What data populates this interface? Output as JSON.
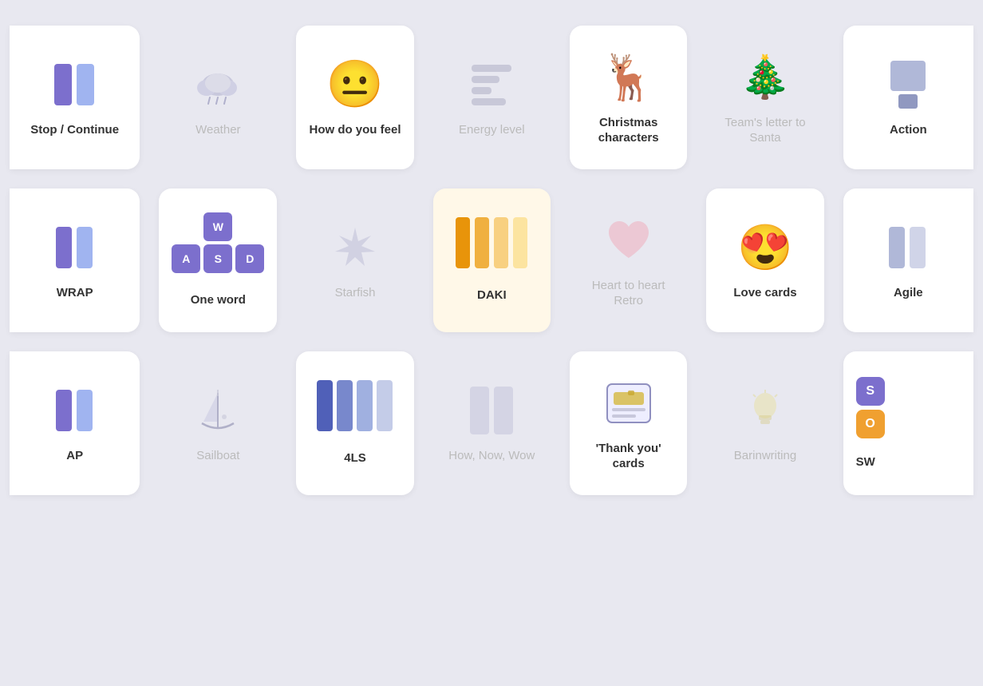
{
  "colors": {
    "background": "#e8e8f0",
    "card": "#ffffff",
    "faded_label": "#aaaaaa",
    "purple": "#7c6fcd",
    "light_purple": "#b0a8e8",
    "orange_dark": "#e8940a",
    "orange_mid": "#f0b040",
    "orange_light": "#f8d080",
    "blue_dark": "#5060b8",
    "blue_mid": "#8890d0",
    "blue_light": "#b8c0e8"
  },
  "rows": [
    {
      "cards": [
        {
          "id": "stop-continue",
          "label": "Stop / Continue",
          "type": "partial-left",
          "faded": false
        },
        {
          "id": "weather",
          "label": "Weather",
          "type": "faded",
          "faded": true
        },
        {
          "id": "how-do-you-feel",
          "label": "How do you feel",
          "type": "normal",
          "faded": false
        },
        {
          "id": "energy-level",
          "label": "Energy level",
          "type": "faded",
          "faded": true
        },
        {
          "id": "christmas-characters",
          "label": "Christmas characters",
          "type": "normal",
          "faded": false
        },
        {
          "id": "teams-letter",
          "label": "Team's letter to Santa",
          "type": "faded",
          "faded": true
        },
        {
          "id": "action",
          "label": "Action",
          "type": "partial-right",
          "faded": false
        }
      ]
    },
    {
      "cards": [
        {
          "id": "wrap",
          "label": "WRAP",
          "type": "partial-left",
          "faded": false
        },
        {
          "id": "one-word",
          "label": "One word",
          "type": "normal",
          "faded": false
        },
        {
          "id": "starfish",
          "label": "Starfish",
          "type": "faded",
          "faded": true
        },
        {
          "id": "daki",
          "label": "DAKI",
          "type": "normal",
          "faded": false
        },
        {
          "id": "heart-retro",
          "label": "Heart to heart Retro",
          "type": "faded",
          "faded": true
        },
        {
          "id": "love-cards",
          "label": "Love cards",
          "type": "normal",
          "faded": false
        },
        {
          "id": "agile",
          "label": "Agile",
          "type": "partial-right",
          "faded": false
        }
      ]
    },
    {
      "cards": [
        {
          "id": "wrap2",
          "label": "AP",
          "type": "partial-left",
          "faded": false
        },
        {
          "id": "sailboat",
          "label": "Sailboat",
          "type": "faded",
          "faded": true
        },
        {
          "id": "4ls",
          "label": "4LS",
          "type": "normal",
          "faded": false
        },
        {
          "id": "how-now-wow",
          "label": "How, Now, Wow",
          "type": "faded",
          "faded": true
        },
        {
          "id": "thank-you",
          "label": "'Thank you' cards",
          "type": "normal",
          "faded": false
        },
        {
          "id": "barinwriting",
          "label": "Barinwriting",
          "type": "faded",
          "faded": true
        },
        {
          "id": "sw",
          "label": "SW",
          "type": "partial-right",
          "faded": false
        }
      ]
    }
  ]
}
